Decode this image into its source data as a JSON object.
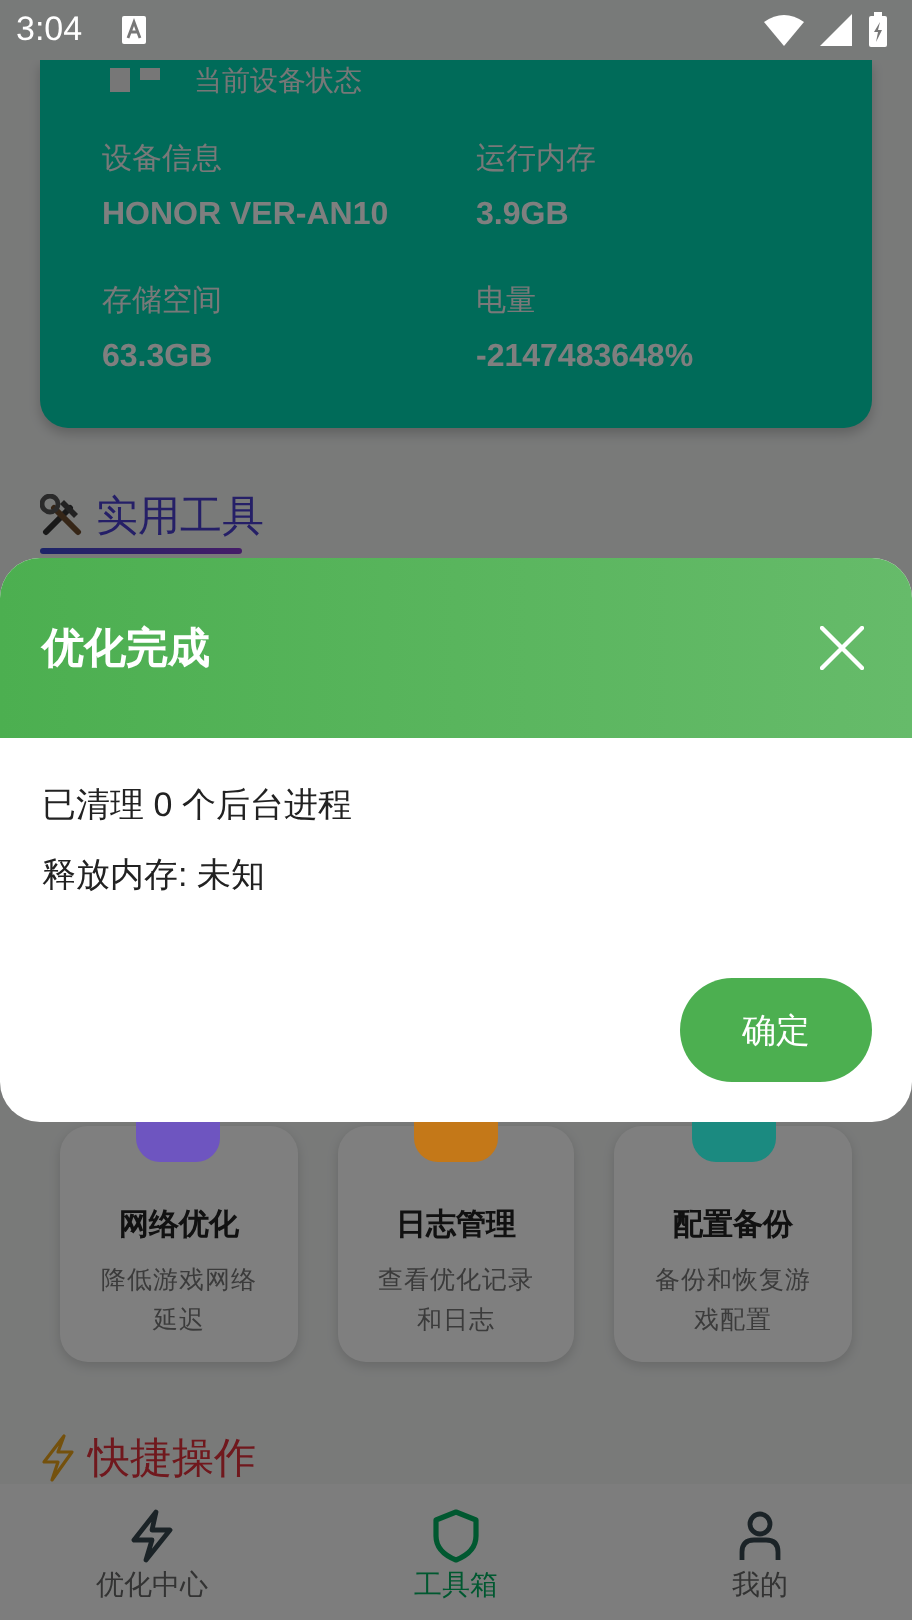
{
  "status_bar": {
    "time": "3:04"
  },
  "device_card": {
    "subtitle": "当前设备状态",
    "stats": [
      {
        "label": "设备信息",
        "value": "HONOR VER-AN10"
      },
      {
        "label": "运行内存",
        "value": "3.9GB"
      },
      {
        "label": "存储空间",
        "value": "63.3GB"
      },
      {
        "label": "电量",
        "value": "-2147483648%"
      }
    ]
  },
  "tools_section": {
    "title": "实用工具",
    "tools": [
      {
        "title": "网络优化",
        "description": "降低游戏网络延迟",
        "color": "#6e55c0"
      },
      {
        "title": "日志管理",
        "description": "查看优化记录和日志",
        "color": "#c47818"
      },
      {
        "title": "配置备份",
        "description": "备份和恢复游戏配置",
        "color": "#1b8a80"
      }
    ]
  },
  "quick_actions": {
    "title": "快捷操作"
  },
  "bottom_nav": {
    "items": [
      {
        "label": "优化中心",
        "kind": "bolt",
        "selected": false
      },
      {
        "label": "工具箱",
        "kind": "shield",
        "selected": true
      },
      {
        "label": "我的",
        "kind": "person",
        "selected": false
      }
    ]
  },
  "dialog": {
    "title": "优化完成",
    "lines": [
      "已清理 0 个后台进程",
      "释放内存: 未知"
    ],
    "confirm": "确定"
  }
}
